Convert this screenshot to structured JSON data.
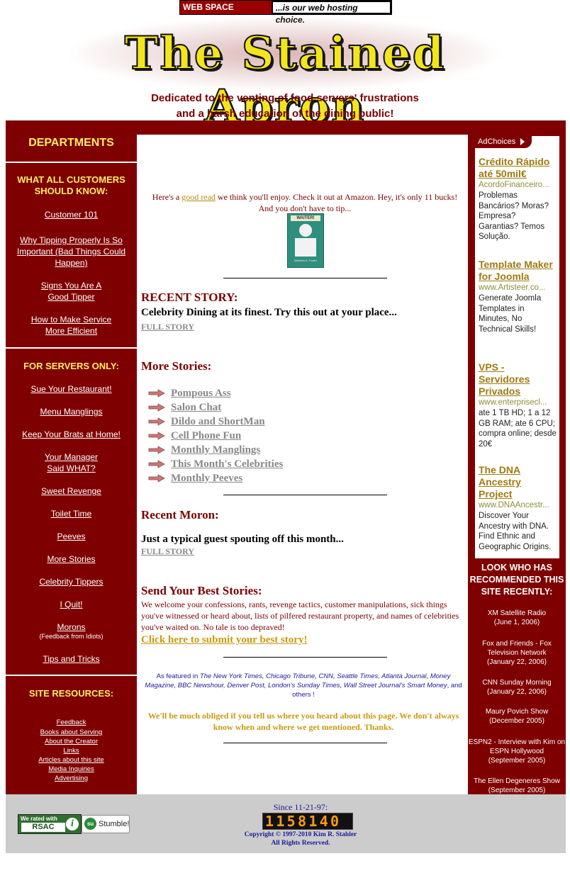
{
  "banner": {
    "part1": "WEB SPACE OUTLET",
    "part2": "...is our web hosting choice."
  },
  "logo": {
    "text": "The Stained Apron"
  },
  "tagline": {
    "line1": "Dedicated to the venting of food servers' frustrations",
    "line2": "and a harsh education of the dining public!"
  },
  "left": {
    "departments": "DEPARTMENTS",
    "customers_head": "WHAT ALL CUSTOMERS SHOULD KNOW:",
    "customers_links": [
      "Customer 101",
      "Why Tipping Properly Is So Important (Bad Things Could Happen)",
      "Signs You Are A Good Tipper",
      "How to Make Service More Efficient"
    ],
    "servers_head": "FOR SERVERS ONLY:",
    "servers_links": [
      "Sue Your Restaurant!",
      "Menu Manglings",
      "Keep Your Brats at Home!",
      "Your Manager Said WHAT?",
      "Sweet Revenge",
      "Toilet Time",
      "Peeves",
      "More Stories",
      "Celebrity Tippers",
      "I Quit!",
      "Morons",
      "Tips and Tricks"
    ],
    "morons_sub": "(Feedback from Idiots)",
    "resources_head": "SITE RESOURCES:",
    "resources_links": [
      "Feedback",
      "Books about Serving",
      "About the Creator",
      "Links",
      "Articles about this site",
      "Media Inquiries",
      "Advertising"
    ]
  },
  "main": {
    "intro_pre": "Here's a ",
    "intro_link": "good read",
    "intro_post": " we think you'll enjoy. Check it out at Amazon. Hey, it's only 11 bucks! And you don't have to tip...",
    "book_title": "WAITER!",
    "book_author": "Matthew A. Foster",
    "recent_story_head": "RECENT STORY:",
    "recent_story_text": "Celebrity Dining at its finest. Try this out at your place...",
    "full_story": "FULL STORY",
    "more_stories_head": "More Stories:",
    "stories": [
      "Pompous Ass",
      "Salon Chat",
      "Dildo and ShortMan",
      "Cell Phone Fun",
      "Monthly Manglings",
      "This Month's Celebrities",
      "Monthly Peeves"
    ],
    "moron_head": "Recent Moron:",
    "moron_text": "Just a typical guest spouting off this month...",
    "send_head": "Send Your Best Stories:",
    "send_text": "We welcome your confessions, rants, revenge tactics, customer manipulations, sick things you've witnessed or heard about, lists of pilfered restaurant property, and names of celebrities you've waited on. No tale is too depraved!",
    "send_link": "Click here to submit your best story!",
    "featured_pre": "As featured in ",
    "featured_list": "The New York Times, Chicago Tribune, CNN, Seattle Times, Atlanta Journal, Money Magazine, BBC Newshour, Denver Post, London's Sunday Times, Wall Street Journal's Smart Money",
    "featured_post": ", and others !",
    "obliged": "We'll be much obliged if you tell us where you heard about this page. We don't always know when and where we get mentioned. Thanks."
  },
  "ads": {
    "adchoices": "AdChoices",
    "items": [
      {
        "title": "Crédito Rápido até 50mil€",
        "url": "AcordoFinanceiro...",
        "desc": "Problemas Bancários? Moras? Empresa? Garantias? Temos Solução."
      },
      {
        "title": "Template Maker for Joomla",
        "url": "www.Artisteer.co...",
        "desc": "Generate Joomla Templates in Minutes, No Technical Skills!"
      },
      {
        "title": "VPS - Servidores Privados",
        "url": "www.enterprisecl...",
        "desc": "ate 1 TB HD; 1 a 12 GB RAM; ate 6 CPU; compra online; desde 20€"
      },
      {
        "title": "The DNA Ancestry Project",
        "url": "www.DNAAncestr...",
        "desc": "Discover Your Ancestry with DNA. Find Ethnic and Geographic Origins."
      }
    ]
  },
  "recommended": {
    "head": "LOOK WHO HAS RECOMMENDED THIS SITE RECENTLY:",
    "items": [
      {
        "name": "XM Satellite Radio",
        "date": "(June 1, 2006)"
      },
      {
        "name": "Fox and Friends - Fox Television Network",
        "date": "(January 22, 2006)"
      },
      {
        "name": "CNN Sunday Morning",
        "date": "(January 22, 2006)"
      },
      {
        "name": "Maury Povich Show",
        "date": "(December 2005)"
      },
      {
        "name": "ESPN2 - Interview with Kim on ESPN Hollywood",
        "date": "(September 2005)"
      },
      {
        "name": "The Ellen Degeneres Show",
        "date": "(September 2005)"
      }
    ]
  },
  "footer": {
    "rsac_line1": "We rated with",
    "rsac_line2": "RSAC",
    "stumble": "Stumble!",
    "since": "Since 11-21-97:",
    "counter": "1158140",
    "copyright": "Copyright © 1997-2010 Kim R. Stahler",
    "rights": "All Rights Reserved."
  },
  "colors": {
    "maroon": "#7f0000",
    "gold": "#ffee66",
    "ad_title": "#a07a10",
    "footer_bg": "#cccccc"
  }
}
